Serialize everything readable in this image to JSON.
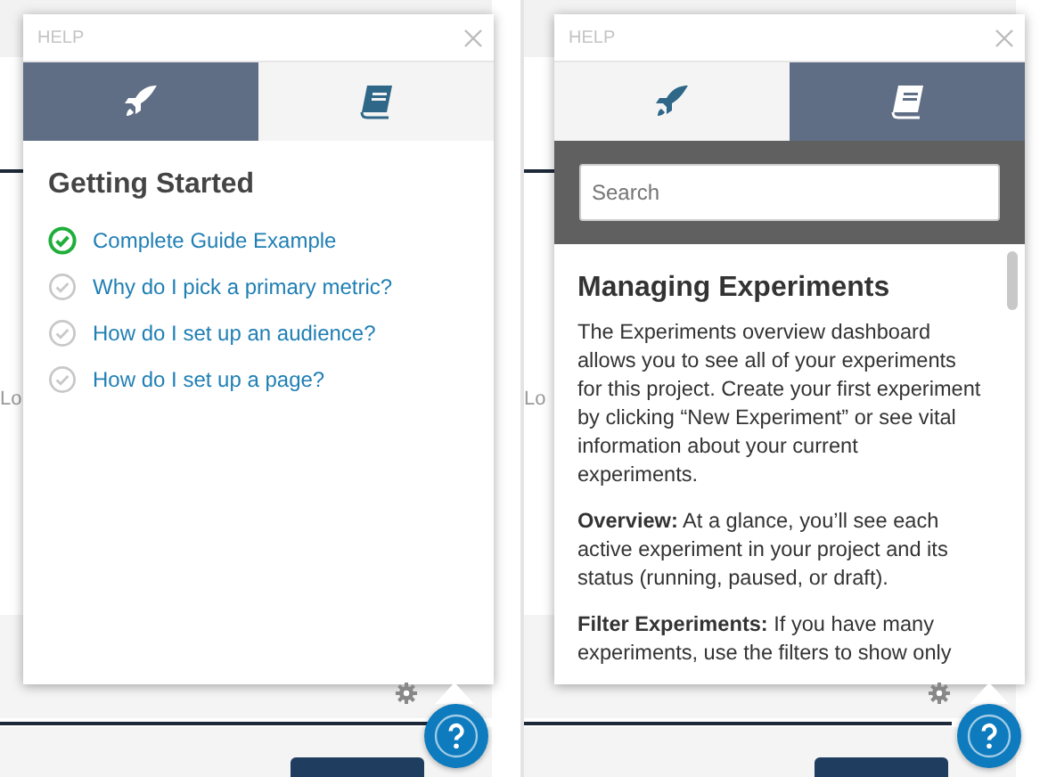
{
  "screens": [
    {
      "background_text": "Lo",
      "panel": {
        "title": "HELP",
        "tabs": [
          {
            "kind": "rocket",
            "selected": true
          },
          {
            "kind": "book",
            "selected": false
          }
        ],
        "content": {
          "kind": "guide",
          "heading": "Getting Started",
          "items": [
            {
              "label": "Complete Guide Example",
              "checked": true
            },
            {
              "label": "Why do I pick a primary metric?",
              "checked": false
            },
            {
              "label": "How do I set up an audience?",
              "checked": false
            },
            {
              "label": "How do I set up a page?",
              "checked": false
            }
          ]
        }
      }
    },
    {
      "background_text": "Lo",
      "panel": {
        "title": "HELP",
        "tabs": [
          {
            "kind": "rocket",
            "selected": false
          },
          {
            "kind": "book",
            "selected": true
          }
        ],
        "content": {
          "kind": "article",
          "search": {
            "placeholder": "Search"
          },
          "heading": "Managing Experiments",
          "paragraphs": [
            "The Experiments overview dashboard allows you to see all of your experiments for this project. Create your first experiment by clicking “New Experiment” or see vital information about your current experiments.",
            "**Overview:** At a glance, you’ll see each active experiment in your project and its status (running, paused, or draft).",
            "**Filter Experiments:** If you have many experiments, use the filters to show only"
          ]
        }
      }
    }
  ]
}
